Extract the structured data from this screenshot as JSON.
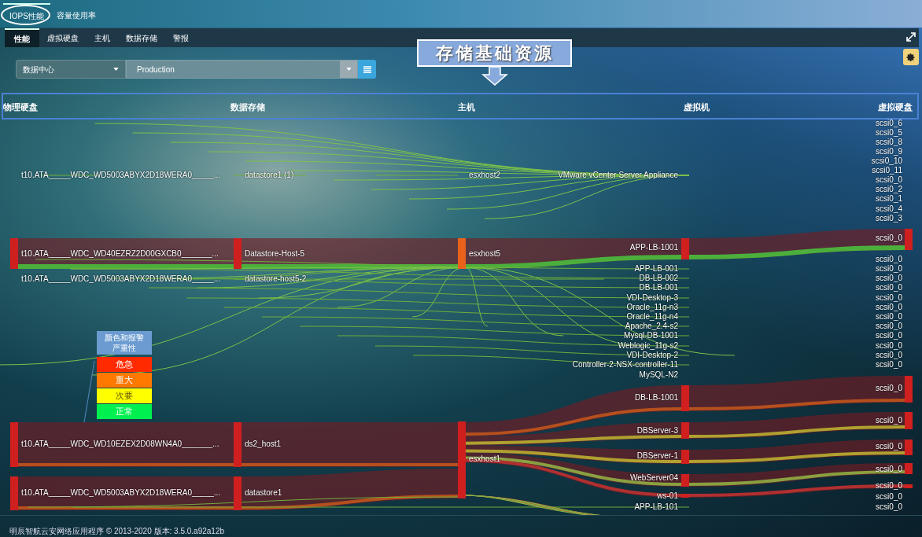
{
  "top_tabs": [
    {
      "label": "IOPS性能",
      "selected": true
    },
    {
      "label": "容量使用率",
      "selected": false
    }
  ],
  "tabs": [
    {
      "label": "性能",
      "selected": true
    },
    {
      "label": "虚拟硬盘",
      "selected": false
    },
    {
      "label": "主机",
      "selected": false
    },
    {
      "label": "数据存储",
      "selected": false
    },
    {
      "label": "警报",
      "selected": false
    }
  ],
  "filters": {
    "scope": "数据中心",
    "value": "Production"
  },
  "callout": "存储基础资源",
  "columns": [
    {
      "header": "物理硬盘",
      "nodes": [
        {
          "label": "t10.ATA_____WDC_WD5003ABYX2D18WERA0_____..."
        },
        {
          "label": "t10.ATA_____WDC_WD40EZRZ2D00GXCB0_______...",
          "color": "#d01f1f"
        },
        {
          "label": "t10.ATA_____WDC_WD5003ABYX2D18WERA0_____..."
        },
        {
          "label": "t10.ATA_____WDC_WD10EZEX2D08WN4A0_______...",
          "color": "#d01f1f"
        },
        {
          "label": "t10.ATA_____WDC_WD5003ABYX2D18WERA0_____...",
          "color": "#d01f1f"
        }
      ]
    },
    {
      "header": "数据存储",
      "nodes": [
        {
          "label": "datastore1 (1)"
        },
        {
          "label": "Datastore-Host-5",
          "color": "#d01f1f"
        },
        {
          "label": "datastore-host5-2"
        },
        {
          "label": "ds2_host1",
          "color": "#d01f1f"
        },
        {
          "label": "datastore1",
          "color": "#d01f1f"
        }
      ]
    },
    {
      "header": "主机",
      "nodes": [
        {
          "label": "esxhost2"
        },
        {
          "label": "esxhost5",
          "color": "#e8621c"
        },
        {
          "label": "esxhost1",
          "color": "#d01f1f"
        }
      ]
    },
    {
      "header": "虚拟机",
      "nodes": [
        {
          "label": "VMware vCenter Server Appliance"
        },
        {
          "label": "APP-LB-1001",
          "color": "#d01f1f"
        },
        {
          "label": "APP-LB-001"
        },
        {
          "label": "DB-LB-002"
        },
        {
          "label": "DB-LB-001"
        },
        {
          "label": "VDI-Desktop-3"
        },
        {
          "label": "Oracle_11g-n3"
        },
        {
          "label": "Oracle_11g-n4"
        },
        {
          "label": "Apache_2.4-s2"
        },
        {
          "label": "Mysql-DB-1001"
        },
        {
          "label": "Weblogic_11g-s2"
        },
        {
          "label": "VDI-Desktop-2"
        },
        {
          "label": "Controller-2-NSX-controller-11"
        },
        {
          "label": "MySQL-N2"
        },
        {
          "label": "DB-LB-1001",
          "color": "#d01f1f"
        },
        {
          "label": "DBServer-3",
          "color": "#d01f1f"
        },
        {
          "label": "DBServer-1",
          "color": "#d01f1f"
        },
        {
          "label": "WebServer04",
          "color": "#d01f1f"
        },
        {
          "label": "ws-01",
          "color": "#d01f1f"
        },
        {
          "label": "APP-LB-101"
        }
      ]
    },
    {
      "header": "虚拟硬盘",
      "nodes": [
        {
          "label": "scsi0_6"
        },
        {
          "label": "scsi0_5"
        },
        {
          "label": "scsi0_8"
        },
        {
          "label": "scsi0_9"
        },
        {
          "label": "scsi0_10"
        },
        {
          "label": "scsi0_11"
        },
        {
          "label": "scsi0_0"
        },
        {
          "label": "scsi0_2"
        },
        {
          "label": "scsi0_1"
        },
        {
          "label": "scsi0_4"
        },
        {
          "label": "scsi0_3"
        },
        {
          "label": "scsi0_0",
          "color": "#d01f1f"
        },
        {
          "label": "scsi0_0"
        },
        {
          "label": "scsi0_0"
        },
        {
          "label": "scsi0_0"
        },
        {
          "label": "scsi0_0"
        },
        {
          "label": "scsi0_0"
        },
        {
          "label": "scsi0_0"
        },
        {
          "label": "scsi0_0"
        },
        {
          "label": "scsi0_0"
        },
        {
          "label": "scsi0_0"
        },
        {
          "label": "scsi0_0"
        },
        {
          "label": "scsi0_0"
        },
        {
          "label": "scsi0_0"
        },
        {
          "label": "scsi0_0",
          "color": "#d01f1f"
        },
        {
          "label": "scsi0_0",
          "color": "#d01f1f"
        },
        {
          "label": "scsi0_0",
          "color": "#d01f1f"
        },
        {
          "label": "scsi0_0",
          "color": "#d01f1f"
        },
        {
          "label": "scsi0_0",
          "color": "#d01f1f"
        },
        {
          "label": "scsi0_0"
        },
        {
          "label": "scsi0_0"
        }
      ]
    }
  ],
  "legend": {
    "title": "颜色和报警严重性",
    "levels": [
      {
        "label": "危急",
        "color": "#ff2a00"
      },
      {
        "label": "重大",
        "color": "#ff7800"
      },
      {
        "label": "次要",
        "color": "#ffff00"
      },
      {
        "label": "正常",
        "color": "#00f050"
      }
    ]
  },
  "footer": "明辰智航云安网络应用程序 © 2013-2020 版本: 3.5.0.a92a12b"
}
